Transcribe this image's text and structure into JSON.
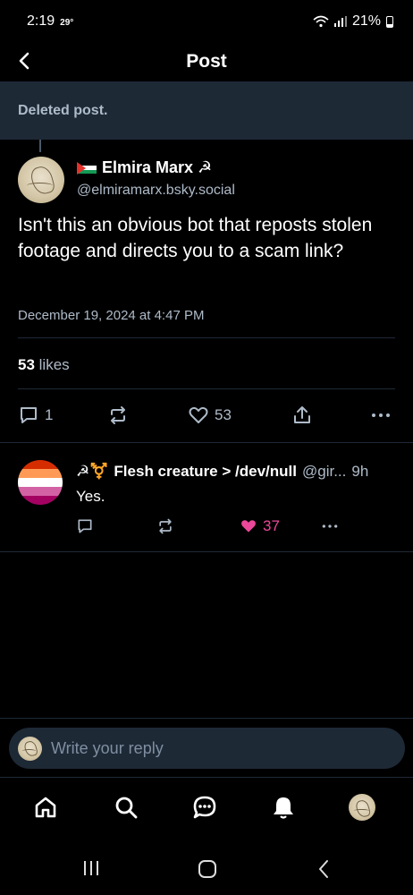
{
  "status_bar": {
    "time": "2:19",
    "temperature": "29°",
    "battery": "21%"
  },
  "header": {
    "title": "Post"
  },
  "parent": {
    "deleted_text": "Deleted post."
  },
  "post": {
    "author_name": "Elmira Marx ☭",
    "author_handle": "@elmiramarx.bsky.social",
    "text": "Isn't this an obvious bot that reposts stolen footage and directs you to a scam link?",
    "date": "December 19, 2024 at 4:47 PM",
    "likes_count": "53",
    "likes_label": "likes",
    "reply_count": "1",
    "like_count_action": "53"
  },
  "reply": {
    "author_emoji": "☭⚧️",
    "author_name": "Flesh creature > /dev/null",
    "author_handle": "@gir...",
    "time": "9h",
    "text": "Yes.",
    "like_count": "37"
  },
  "composer": {
    "placeholder": "Write your reply"
  },
  "colors": {
    "background": "#000000",
    "banner": "#1e2936",
    "muted_text": "#aebbc9",
    "like_active": "#ec4899"
  },
  "icons": {
    "back": "chevron-left-icon",
    "reply": "speech-bubble-icon",
    "repost": "repost-arrows-icon",
    "like": "heart-icon",
    "share": "share-icon",
    "more": "ellipsis-icon",
    "nav": [
      "home-icon",
      "search-icon",
      "chat-icon",
      "bell-icon",
      "profile-avatar"
    ],
    "system": [
      "recents-icon",
      "home-circle-icon",
      "back-chevron-icon"
    ]
  }
}
